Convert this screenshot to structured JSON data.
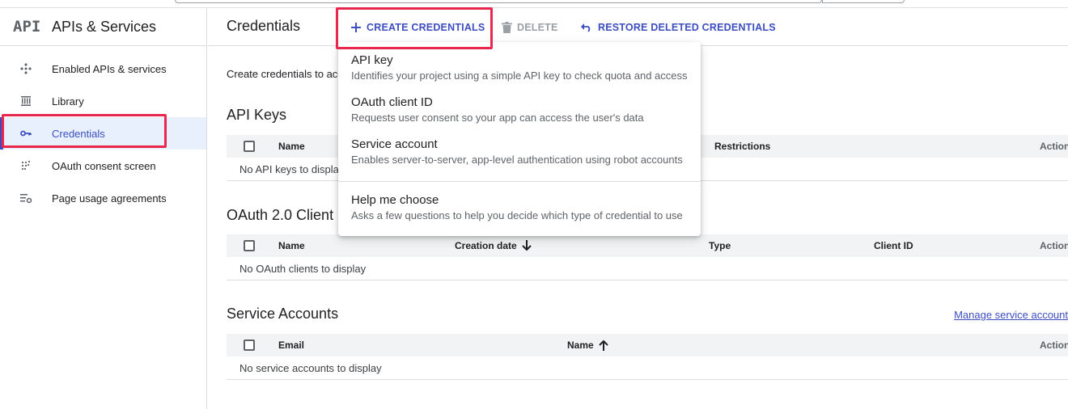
{
  "sidebar": {
    "logo": "API",
    "title": "APIs & Services",
    "items": [
      {
        "label": "Enabled APIs & services",
        "icon": "api-hub-icon"
      },
      {
        "label": "Library",
        "icon": "library-icon"
      },
      {
        "label": "Credentials",
        "icon": "key-icon",
        "active": true
      },
      {
        "label": "OAuth consent screen",
        "icon": "consent-dots-icon"
      },
      {
        "label": "Page usage agreements",
        "icon": "settings-list-icon"
      }
    ]
  },
  "toolbar": {
    "title": "Credentials",
    "create_label": "CREATE CREDENTIALS",
    "delete_label": "DELETE",
    "restore_label": "RESTORE DELETED CREDENTIALS"
  },
  "main": {
    "intro": "Create credentials to acc",
    "api_keys": {
      "title": "API Keys",
      "col_name": "Name",
      "col_restrictions": "Restrictions",
      "col_actions": "Action",
      "empty": "No API keys to displa"
    },
    "oauth": {
      "title": "OAuth 2.0 Client I",
      "col_name": "Name",
      "col_created": "Creation date",
      "col_type": "Type",
      "col_client_id": "Client ID",
      "col_actions": "Action",
      "empty": "No OAuth clients to display"
    },
    "service_accounts": {
      "title": "Service Accounts",
      "manage_link": "Manage service account",
      "col_email": "Email",
      "col_name": "Name",
      "col_actions": "Action",
      "empty": "No service accounts to display"
    }
  },
  "menu": {
    "items": [
      {
        "title": "API key",
        "desc": "Identifies your project using a simple API key to check quota and access"
      },
      {
        "title": "OAuth client ID",
        "desc": "Requests user consent so your app can access the user's data"
      },
      {
        "title": "Service account",
        "desc": "Enables server-to-server, app-level authentication using robot accounts"
      },
      {
        "title": "Help me choose",
        "desc": "Asks a few questions to help you decide which type of credential to use"
      }
    ]
  },
  "colors": {
    "accent": "#3c4ec0",
    "highlight": "#e9264d",
    "active_bg": "#e8f0fe"
  }
}
